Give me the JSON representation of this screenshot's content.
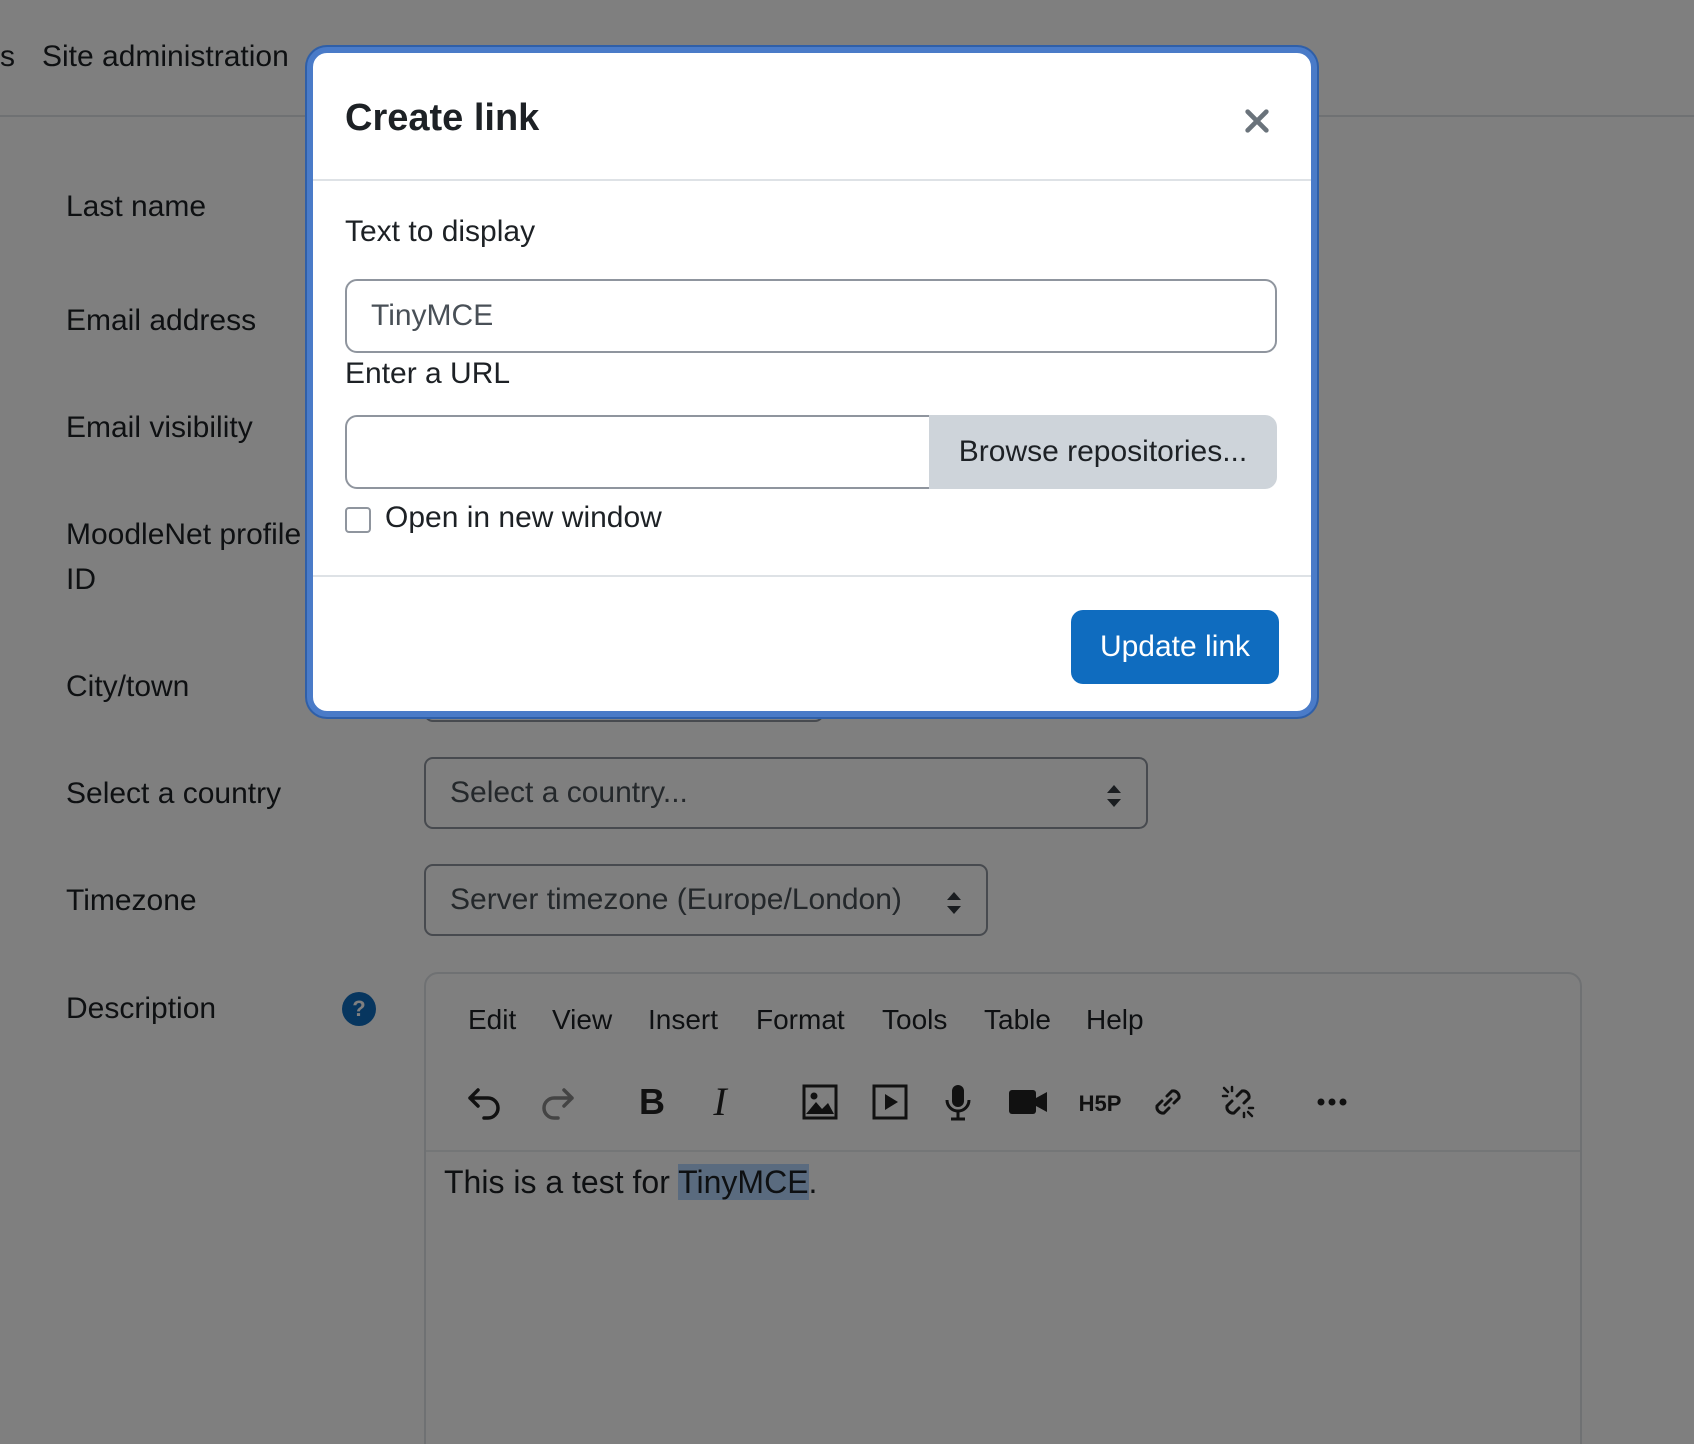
{
  "nav": {
    "fragment": "s",
    "site_admin": "Site administration"
  },
  "form": {
    "last_name_label": "Last name",
    "email_label": "Email address",
    "email_visibility_label": "Email visibility",
    "moodlenet_label_line1": "MoodleNet profile",
    "moodlenet_label_line2": "ID",
    "city_label": "City/town",
    "country_label": "Select a country",
    "country_value": "Select a country...",
    "timezone_label": "Timezone",
    "timezone_value": "Server timezone (Europe/London)",
    "description_label": "Description",
    "help_glyph": "?"
  },
  "editor": {
    "menu": [
      "Edit",
      "View",
      "Insert",
      "Format",
      "Tools",
      "Table",
      "Help"
    ],
    "toolbar_icons": [
      "undo-icon",
      "redo-icon",
      "bold-icon",
      "italic-icon",
      "image-icon",
      "media-icon",
      "microphone-icon",
      "video-camera-icon",
      "h5p-icon",
      "link-icon",
      "unlink-icon",
      "more-icon"
    ],
    "content_before": "This is a test for ",
    "content_selected": "TinyMCE",
    "content_after": "."
  },
  "modal": {
    "title": "Create link",
    "text_label": "Text to display",
    "text_value": "TinyMCE",
    "url_label": "Enter a URL",
    "url_value": "",
    "browse_label": "Browse repositories...",
    "new_window_label": "Open in new window",
    "update_label": "Update link"
  },
  "colors": {
    "primary": "#0f6cbf",
    "modal_border": "#4a7bc8",
    "overlay": "rgba(0,0,0,0.5)"
  }
}
